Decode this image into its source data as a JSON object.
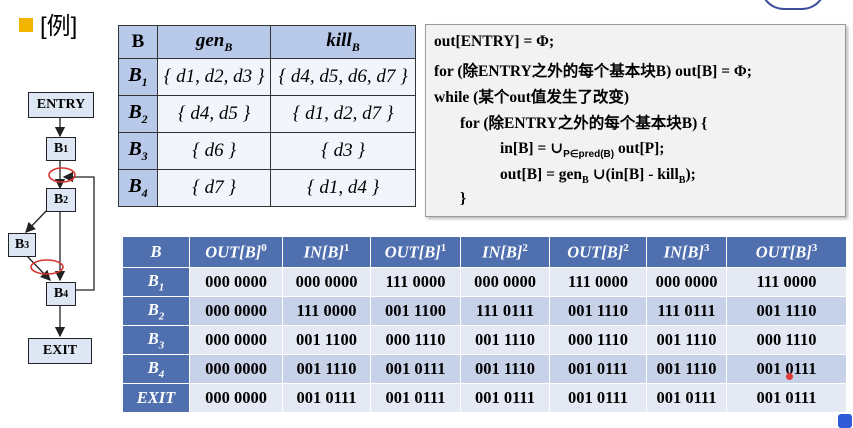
{
  "example_label": "[例]",
  "flow_graph": {
    "nodes": [
      "ENTRY",
      "B1",
      "B2",
      "B3",
      "B4",
      "EXIT"
    ]
  },
  "genkill": {
    "headers": [
      "B",
      "gen",
      "kill"
    ],
    "header_sub": "B",
    "rows": [
      {
        "block": "B",
        "sub": "1",
        "gen": "{ d1, d2, d3 }",
        "kill": "{ d4, d5, d6, d7 }"
      },
      {
        "block": "B",
        "sub": "2",
        "gen": "{ d4, d5 }",
        "kill": "{ d1, d2, d7 }"
      },
      {
        "block": "B",
        "sub": "3",
        "gen": "{ d6 }",
        "kill": "{ d3 }"
      },
      {
        "block": "B",
        "sub": "4",
        "gen": "{ d7 }",
        "kill": "{ d1, d4 }"
      }
    ]
  },
  "algorithm": {
    "line1": "out[ENTRY] = Φ;",
    "line2": "for (除ENTRY之外的每个基本块B) out[B] = Φ;",
    "line3": "while (某个out值发生了改变)",
    "line4": "for (除ENTRY之外的每个基本块B) {",
    "line5a": "in[B] = ∪",
    "line5sub": "P∈pred(B)",
    "line5b": " out[P];",
    "line6a": "out[B] = gen",
    "line6sub1": "B",
    "line6b": " ∪(in[B] - kill",
    "line6sub2": "B",
    "line6c": ");",
    "line7": "}"
  },
  "results": {
    "headers": [
      "B",
      "OUT[B]",
      "IN[B]",
      "OUT[B]",
      "IN[B]",
      "OUT[B]",
      "IN[B]",
      "OUT[B]"
    ],
    "header_sups": [
      "",
      "0",
      "1",
      "1",
      "2",
      "2",
      "3",
      "3"
    ],
    "rows": [
      {
        "block": "B",
        "sub": "1",
        "cells": [
          "000 0000",
          "000 0000",
          "111 0000",
          "000 0000",
          "111 0000",
          "000 0000",
          "111 0000"
        ]
      },
      {
        "block": "B",
        "sub": "2",
        "cells": [
          "000 0000",
          "111 0000",
          "001 1100",
          "111 0111",
          "001 1110",
          "111 0111",
          "001 1110"
        ]
      },
      {
        "block": "B",
        "sub": "3",
        "cells": [
          "000 0000",
          "001 1100",
          "000 1110",
          "001 1110",
          "000 1110",
          "001 1110",
          "000 1110"
        ]
      },
      {
        "block": "B",
        "sub": "4",
        "cells": [
          "000 0000",
          "001 1110",
          "001 0111",
          "001 1110",
          "001 0111",
          "001 1110",
          "001 0111"
        ]
      },
      {
        "block": "EXIT",
        "sub": "",
        "cells": [
          "000 0000",
          "001 0111",
          "001 0111",
          "001 0111",
          "001 0111",
          "001 0111",
          "001 0111"
        ]
      }
    ]
  }
}
